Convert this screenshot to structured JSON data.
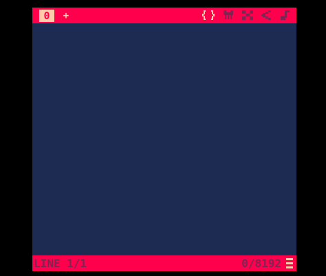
{
  "colors": {
    "bar": "#ff004d",
    "editor_bg": "#1d2b53",
    "icon_active": "#ffccaa",
    "icon_inactive": "#7e2553",
    "outer_bg": "#000000"
  },
  "tabs": {
    "items": [
      {
        "label": "0"
      }
    ],
    "add_label": "+"
  },
  "editors": {
    "icons": [
      {
        "name": "code-editor",
        "icon": "code-braces-icon",
        "active": true
      },
      {
        "name": "sprite-editor",
        "icon": "sprite-icon",
        "active": false
      },
      {
        "name": "map-editor",
        "icon": "map-icon",
        "active": false
      },
      {
        "name": "sfx-editor",
        "icon": "sfx-icon",
        "active": false
      },
      {
        "name": "music-editor",
        "icon": "music-icon",
        "active": false
      }
    ]
  },
  "status": {
    "line": "LINE 1/1",
    "chars": "0/8192"
  }
}
